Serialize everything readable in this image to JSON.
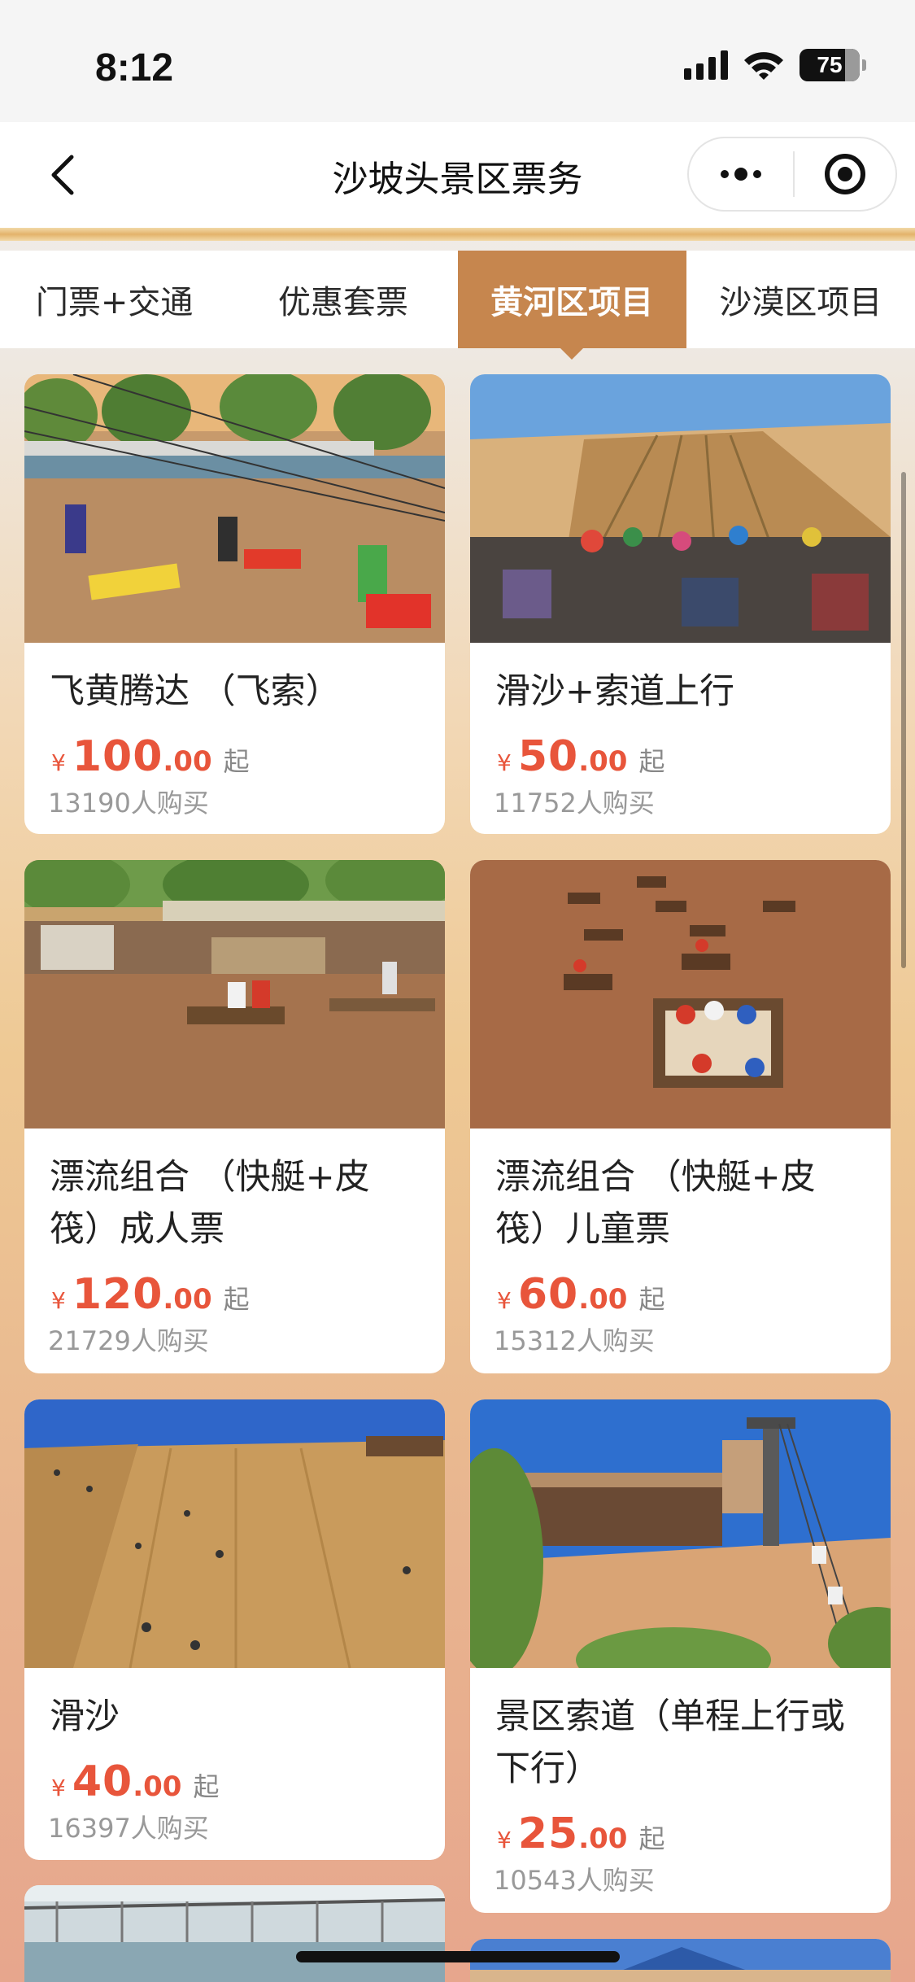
{
  "status_bar": {
    "time": "8:12",
    "battery": "75"
  },
  "nav": {
    "title": "沙坡头景区票务"
  },
  "tabs": [
    {
      "label": "门票+交通",
      "active": false
    },
    {
      "label": "优惠套票",
      "active": false
    },
    {
      "label": "黄河区项目",
      "active": true
    },
    {
      "label": "沙漠区项目",
      "active": false
    }
  ],
  "products": [
    {
      "name": "飞黄腾达 （飞索）",
      "price_symbol": "¥",
      "price_int": "100",
      "price_dec": ".00",
      "price_suffix": "起",
      "sold": "13190人购买"
    },
    {
      "name": "滑沙+索道上行",
      "price_symbol": "¥",
      "price_int": "50",
      "price_dec": ".00",
      "price_suffix": "起",
      "sold": "11752人购买"
    },
    {
      "name": "漂流组合 （快艇+皮筏）成人票",
      "price_symbol": "¥",
      "price_int": "120",
      "price_dec": ".00",
      "price_suffix": "起",
      "sold": "21729人购买"
    },
    {
      "name": "漂流组合 （快艇+皮筏）儿童票",
      "price_symbol": "¥",
      "price_int": "60",
      "price_dec": ".00",
      "price_suffix": "起",
      "sold": "15312人购买"
    },
    {
      "name": "滑沙",
      "price_symbol": "¥",
      "price_int": "40",
      "price_dec": ".00",
      "price_suffix": "起",
      "sold": "16397人购买"
    },
    {
      "name": "景区索道（单程上行或下行）",
      "price_symbol": "¥",
      "price_int": "25",
      "price_dec": ".00",
      "price_suffix": "起",
      "sold": "10543人购买"
    }
  ],
  "colors": {
    "accent": "#c6864e",
    "price": "#e8553b"
  }
}
